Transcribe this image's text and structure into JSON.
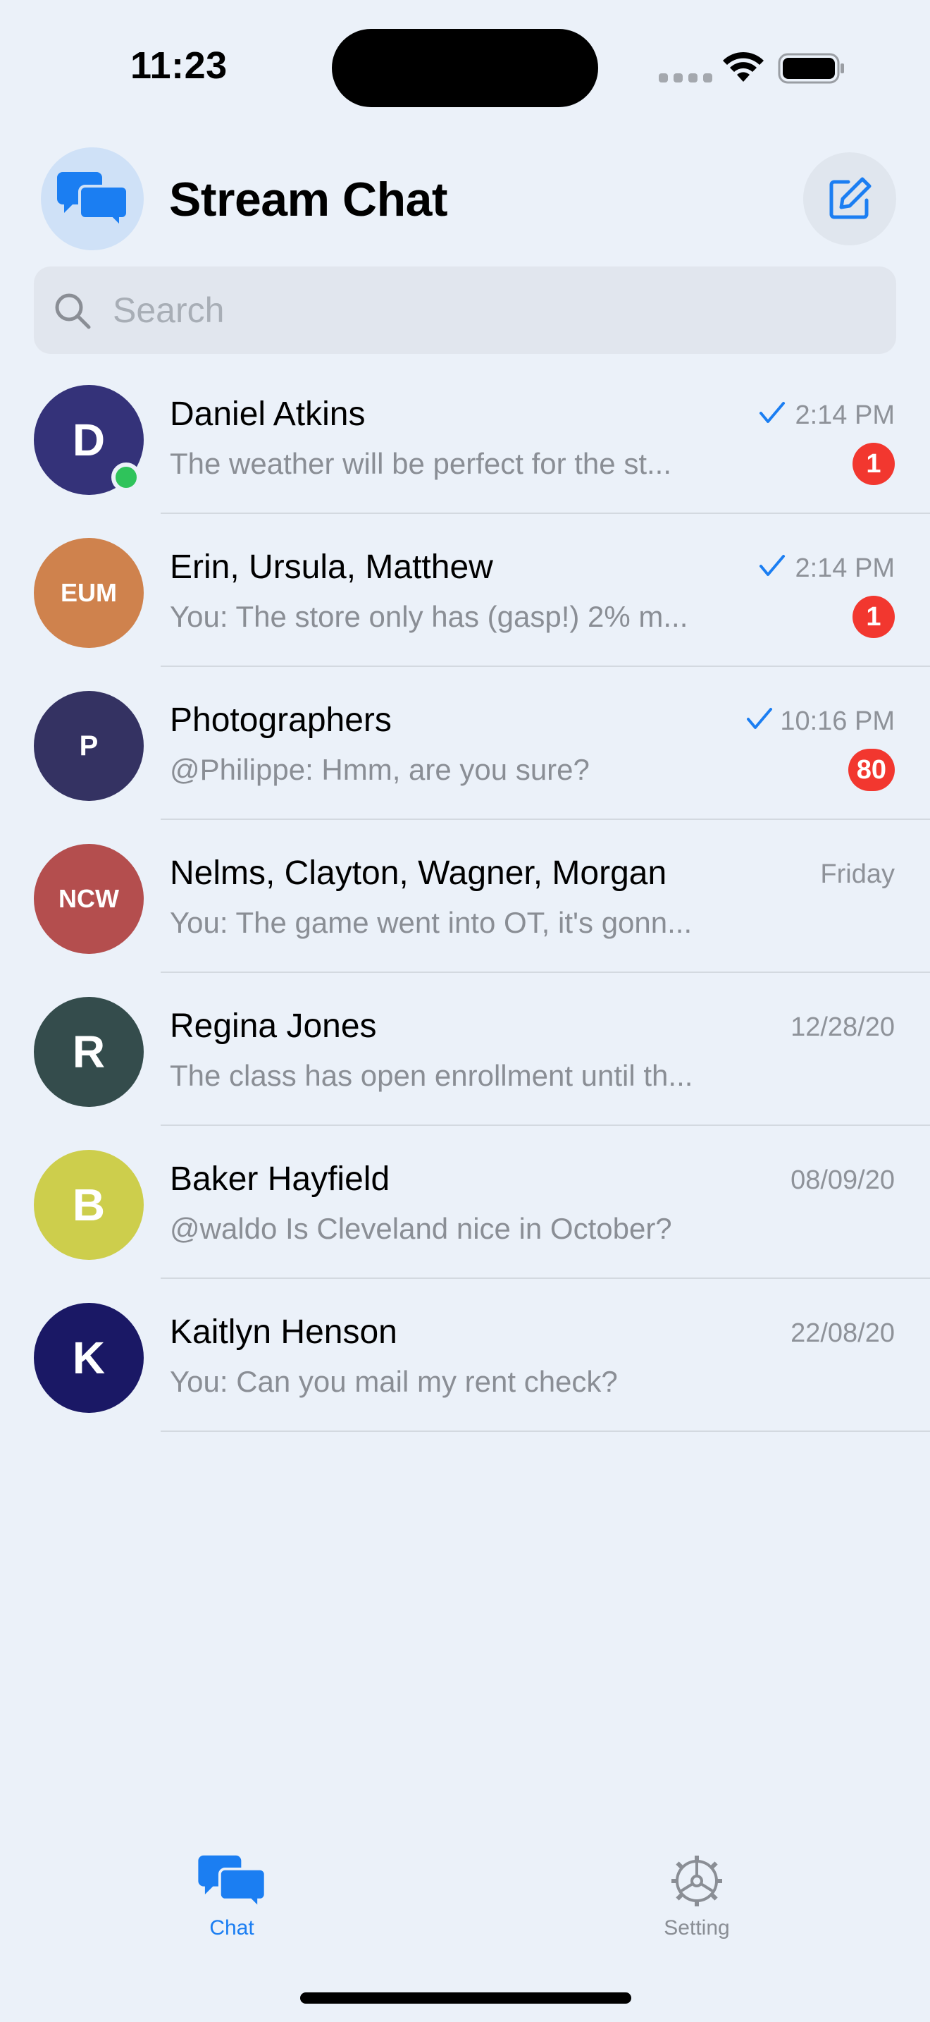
{
  "status_bar": {
    "time": "11:23"
  },
  "header": {
    "title": "Stream Chat"
  },
  "search": {
    "placeholder": "Search"
  },
  "colors": {
    "accent": "#1B7EF2",
    "badge": "#F2372F",
    "online": "#2FC35B"
  },
  "channels": [
    {
      "initials": "D",
      "avatar_color": "#343279",
      "name": "Daniel Atkins",
      "preview": "The weather will be perfect for the st...",
      "time": "2:14 PM",
      "read": true,
      "unread": "1",
      "online": true
    },
    {
      "initials": "EUM",
      "avatar_color": "#CF824D",
      "name": "Erin, Ursula, Matthew",
      "preview": "You: The store only has (gasp!) 2% m...",
      "time": "2:14 PM",
      "read": true,
      "unread": "1",
      "online": false
    },
    {
      "initials": "P",
      "avatar_color": "#343262",
      "name": "Photographers",
      "preview": "@Philippe: Hmm, are you sure?",
      "time": "10:16 PM",
      "read": true,
      "unread": "80",
      "online": false
    },
    {
      "initials": "NCW",
      "avatar_color": "#B44E4E",
      "name": "Nelms, Clayton, Wagner, Morgan",
      "preview": "You: The game went into OT, it's gonn...",
      "time": "Friday",
      "read": false,
      "unread": "",
      "online": false
    },
    {
      "initials": "R",
      "avatar_color": "#344C4C",
      "name": "Regina Jones",
      "preview": "The class has open enrollment until th...",
      "time": "12/28/20",
      "read": false,
      "unread": "",
      "online": false
    },
    {
      "initials": "B",
      "avatar_color": "#CDCE4C",
      "name": "Baker Hayfield",
      "preview": "@waldo Is Cleveland nice in October?",
      "time": "08/09/20",
      "read": false,
      "unread": "",
      "online": false
    },
    {
      "initials": "K",
      "avatar_color": "#1A1865",
      "name": "Kaitlyn Henson",
      "preview": "You: Can you mail my rent check?",
      "time": "22/08/20",
      "read": false,
      "unread": "",
      "online": false
    }
  ],
  "tabs": [
    {
      "label": "Chat",
      "icon": "chat-bubbles-icon",
      "active": true
    },
    {
      "label": "Setting",
      "icon": "gear-icon",
      "active": false
    }
  ]
}
